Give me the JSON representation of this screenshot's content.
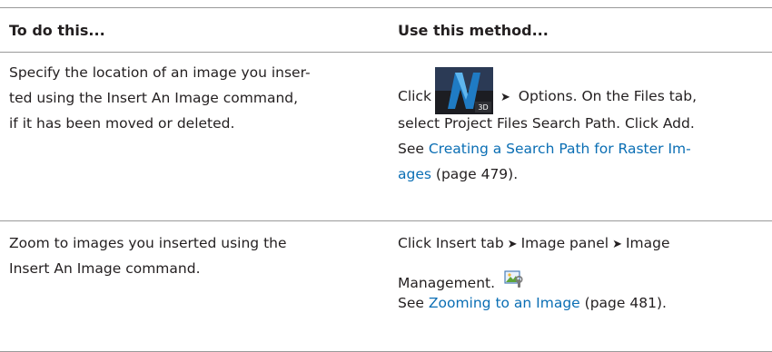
{
  "table": {
    "header": {
      "col1": "To do this...",
      "col2": "Use this method..."
    },
    "rows": [
      {
        "task_lines": [
          "Specify the location of an image you inser-",
          "ted using the Insert An Image command,",
          "if it has been moved or deleted."
        ],
        "method": {
          "click": "Click",
          "after_icon": "Options. On the Files tab,",
          "line2": "select Project Files Search Path. Click Add.",
          "see": "See",
          "link_part1": "Creating a Search Path for Raster Im-",
          "link_part2": "ages",
          "page_ref": "(page 479)."
        }
      },
      {
        "task_lines": [
          "Zoom to images you inserted using the",
          "Insert An Image command."
        ],
        "method": {
          "line1_a": "Click Insert tab",
          "line1_b": "Image panel",
          "line1_c": "Image",
          "line2": "Management.",
          "see": "See",
          "link": "Zooming to an Image",
          "page_ref": "(page 481)."
        }
      }
    ]
  },
  "icons": {
    "arrow": "➤",
    "app_icon": "application-menu-icon",
    "management_icon": "image-management-icon"
  }
}
